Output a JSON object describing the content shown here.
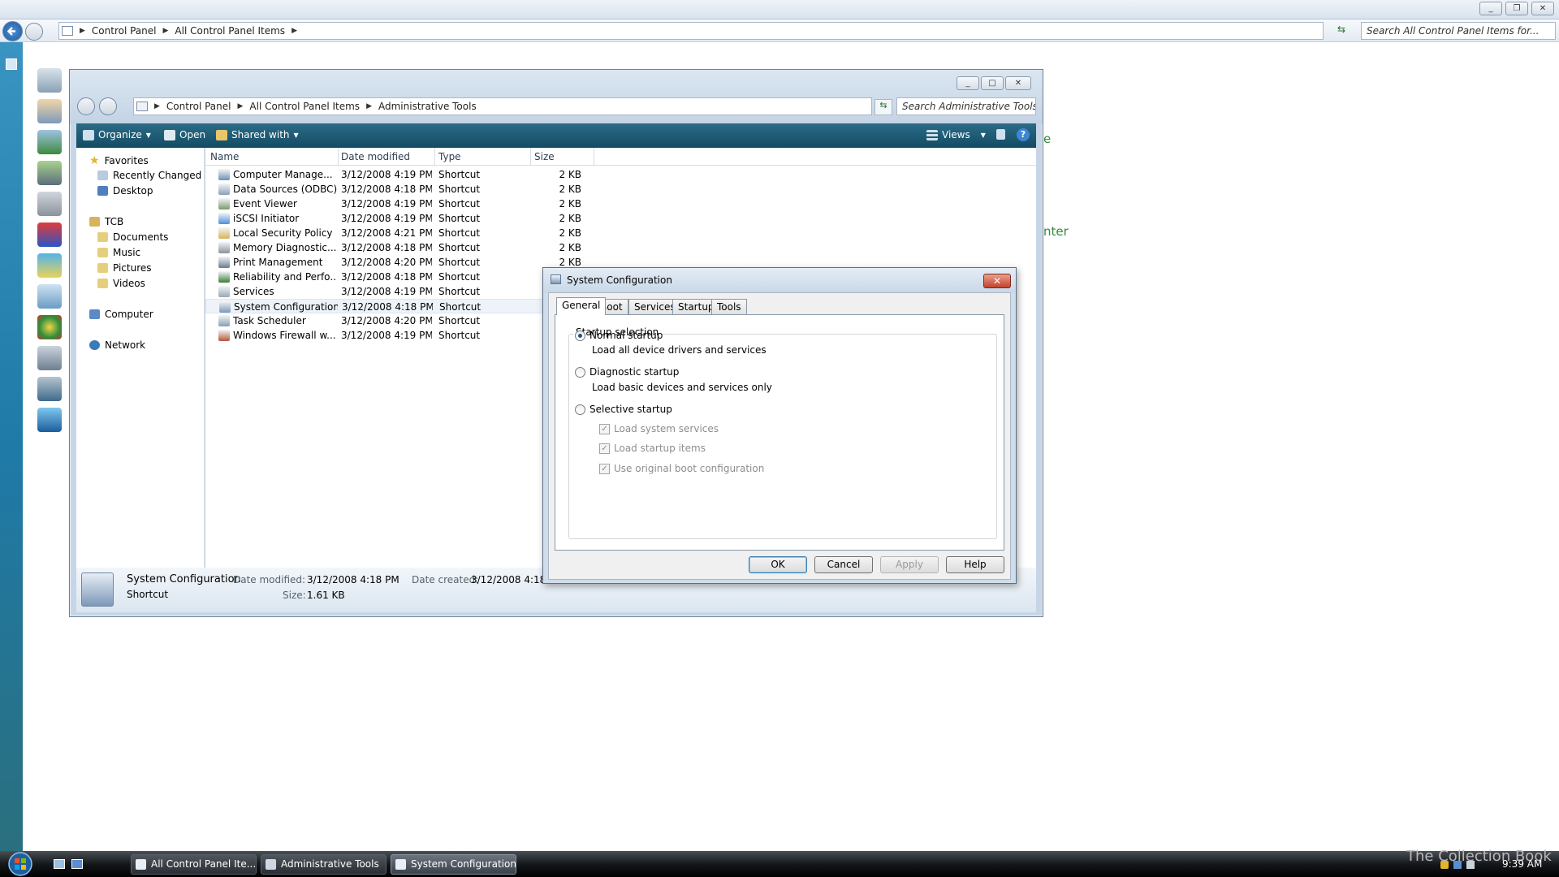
{
  "outer": {
    "breadcrumb": [
      "Control Panel",
      "All Control Panel Items"
    ],
    "search_placeholder": "Search All Control Panel Items for...",
    "partial_text": "nter",
    "partial_text2": "e"
  },
  "window": {
    "breadcrumb": [
      "Control Panel",
      "All Control Panel Items",
      "Administrative Tools"
    ],
    "search_placeholder": "Search Administrative Tools for...",
    "toolbar": {
      "organize": "Organize",
      "open": "Open",
      "shared_with": "Shared with",
      "views": "Views"
    },
    "nav": {
      "favorites": "Favorites",
      "favorites_items": [
        "Recently Changed",
        "Desktop"
      ],
      "tcb": "TCB",
      "tcb_items": [
        "Documents",
        "Music",
        "Pictures",
        "Videos"
      ],
      "computer": "Computer",
      "network": "Network"
    },
    "columns": {
      "name": "Name",
      "date": "Date modified",
      "type": "Type",
      "size": "Size"
    },
    "rows": [
      {
        "name": "Computer Manage...",
        "date": "3/12/2008 4:19 PM",
        "type": "Shortcut",
        "size": "2 KB"
      },
      {
        "name": "Data Sources (ODBC)",
        "date": "3/12/2008 4:18 PM",
        "type": "Shortcut",
        "size": "2 KB"
      },
      {
        "name": "Event Viewer",
        "date": "3/12/2008 4:19 PM",
        "type": "Shortcut",
        "size": "2 KB"
      },
      {
        "name": "iSCSI Initiator",
        "date": "3/12/2008 4:19 PM",
        "type": "Shortcut",
        "size": "2 KB"
      },
      {
        "name": "Local Security Policy",
        "date": "3/12/2008 4:21 PM",
        "type": "Shortcut",
        "size": "2 KB"
      },
      {
        "name": "Memory Diagnostic...",
        "date": "3/12/2008 4:18 PM",
        "type": "Shortcut",
        "size": "2 KB"
      },
      {
        "name": "Print Management",
        "date": "3/12/2008 4:20 PM",
        "type": "Shortcut",
        "size": "2 KB"
      },
      {
        "name": "Reliability and Perfo...",
        "date": "3/12/2008 4:18 PM",
        "type": "Shortcut",
        "size": ""
      },
      {
        "name": "Services",
        "date": "3/12/2008 4:19 PM",
        "type": "Shortcut",
        "size": ""
      },
      {
        "name": "System Configuration",
        "date": "3/12/2008 4:18 PM",
        "type": "Shortcut",
        "size": ""
      },
      {
        "name": "Task Scheduler",
        "date": "3/12/2008 4:20 PM",
        "type": "Shortcut",
        "size": ""
      },
      {
        "name": "Windows Firewall w...",
        "date": "3/12/2008 4:19 PM",
        "type": "Shortcut",
        "size": ""
      }
    ],
    "details": {
      "title": "System Configuration",
      "type": "Shortcut",
      "date_modified_label": "Date modified:",
      "date_modified": "3/12/2008 4:18 PM",
      "size_label": "Size:",
      "size": "1.61 KB",
      "date_created_label": "Date created:",
      "date_created": "3/12/2008 4:18"
    }
  },
  "dialog": {
    "title": "System Configuration",
    "tabs": [
      "General",
      "Boot",
      "Services",
      "Startup",
      "Tools"
    ],
    "group_label": "Startup selection",
    "normal": "Normal startup",
    "normal_desc": "Load all device drivers and services",
    "diagnostic": "Diagnostic startup",
    "diagnostic_desc": "Load basic devices and services only",
    "selective": "Selective startup",
    "chk1": "Load system services",
    "chk2": "Load startup items",
    "chk3": "Use original boot configuration",
    "buttons": {
      "ok": "OK",
      "cancel": "Cancel",
      "apply": "Apply",
      "help": "Help"
    }
  },
  "taskbar": {
    "items": [
      "All Control Panel Ite...",
      "Administrative Tools",
      "System Configuration"
    ],
    "clock": "9:39 AM",
    "watermark": "The Collection Book"
  },
  "colors": {
    "accent": "#1f4f8c",
    "toolbar": "#134b63",
    "link_green": "#2e8b3a"
  }
}
